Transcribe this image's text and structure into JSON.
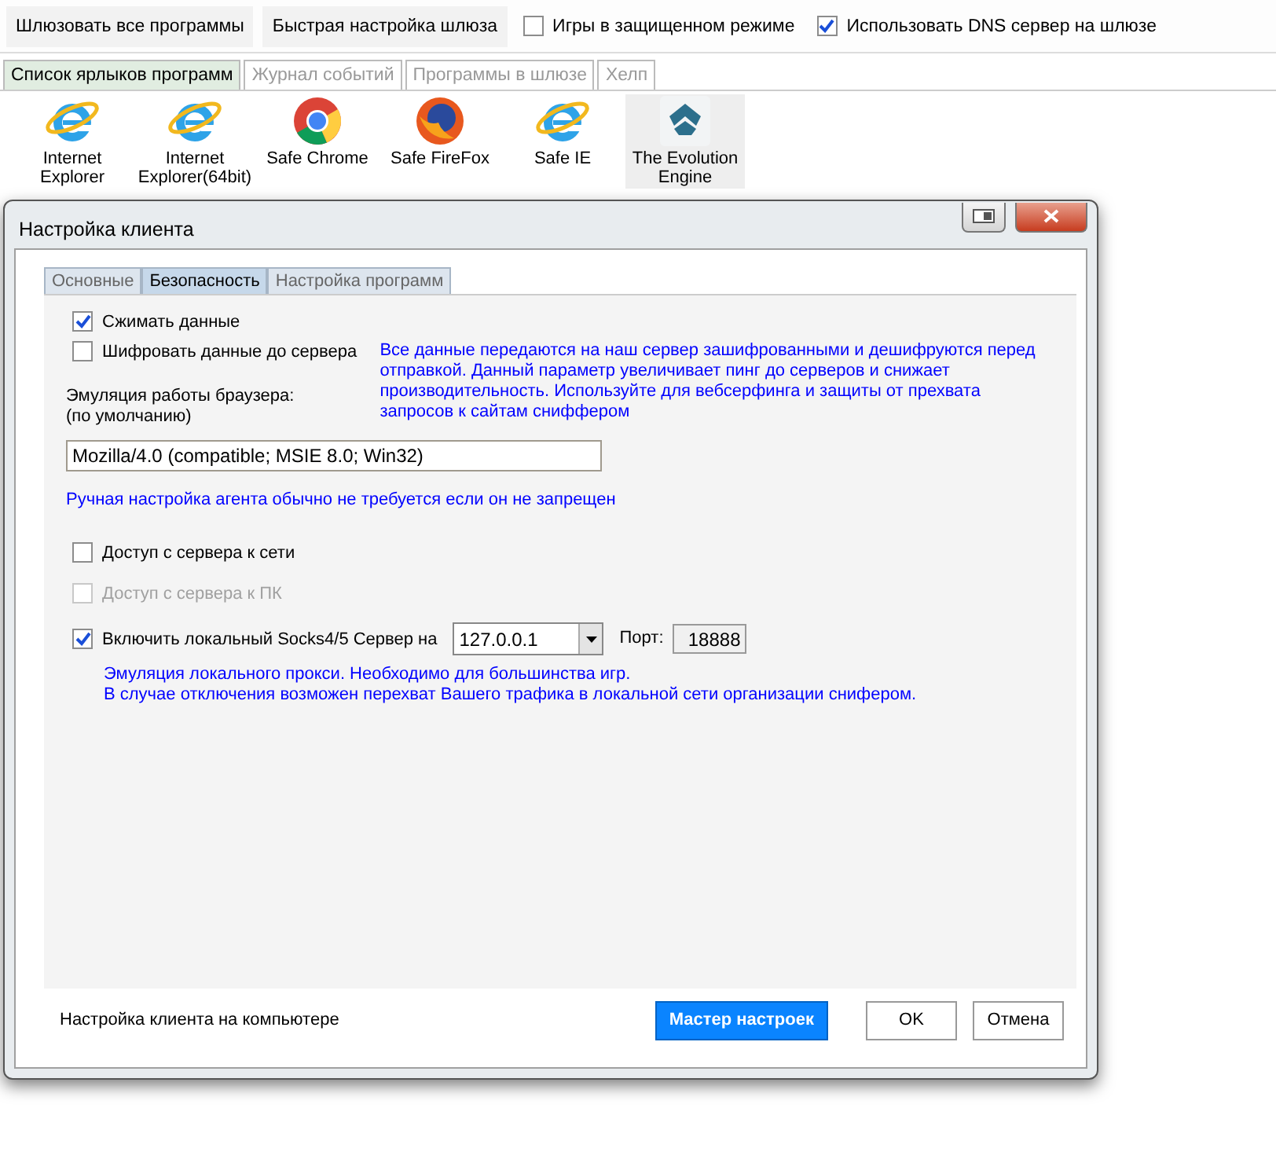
{
  "toolbar": [
    {
      "kind": "button",
      "label": "Шлюзовать все программы"
    },
    {
      "kind": "button",
      "label": "Быстрая настройка шлюза"
    },
    {
      "kind": "checkbox",
      "label": "Игры в защищенном режиме",
      "checked": false
    },
    {
      "kind": "checkbox",
      "label": "Использовать DNS сервер на шлюзе",
      "checked": true
    }
  ],
  "tabs": [
    {
      "label": "Список ярлыков программ",
      "selected": true
    },
    {
      "label": "Журнал событий",
      "selected": false
    },
    {
      "label": "Программы в шлюзе",
      "selected": false
    },
    {
      "label": "Хелп",
      "selected": false
    }
  ],
  "shortcuts": [
    {
      "kind": "ie",
      "label": "Internet\nExplorer",
      "selected": false
    },
    {
      "kind": "ie",
      "label": "Internet\nExplorer(64bit)",
      "selected": false
    },
    {
      "kind": "chrome",
      "label": "Safe Chrome",
      "selected": false
    },
    {
      "kind": "firefox",
      "label": "Safe FireFox",
      "selected": false
    },
    {
      "kind": "ie",
      "label": "Safe IE",
      "selected": false
    },
    {
      "kind": "emblem",
      "label": "The Evolution\nEngine",
      "selected": true
    }
  ],
  "dialog": {
    "title": "Настройка клиента",
    "tabs": [
      {
        "label": "Основные",
        "selected": false
      },
      {
        "label": "Безопасность",
        "selected": true
      },
      {
        "label": "Настройка программ",
        "selected": false
      }
    ],
    "compress": {
      "label": "Сжимать данные",
      "checked": true
    },
    "encrypt": {
      "label": "Шифровать данные до сервера",
      "checked": false
    },
    "encrypt_note": "Все данные передаются на наш сервер зашифрованными и дешифруются перед отправкой. Данный параметр увеличивает пинг до серверов и снижает производительность. Используйте для вебсерфинга и защиты от прехвата запросов к сайтам сниффером",
    "browser_label": [
      "Эмуляция работы браузера:",
      "(по умолчанию)"
    ],
    "user_agent": "Mozilla/4.0 (compatible; MSIE 8.0; Win32)",
    "agent_note": "Ручная настройка агента обычно не требуется если он не запрещен",
    "access": [
      {
        "label": "Доступ с сервера к сети",
        "checked": false,
        "disabled": false
      },
      {
        "label": "Доступ с сервера к ПК",
        "checked": false,
        "disabled": true
      }
    ],
    "socks": {
      "label": "Включить локальный Socks4/5 Сервер на",
      "checked": true,
      "address": "127.0.0.1",
      "port_label": "Порт:",
      "port": "18888"
    },
    "socks_notes": [
      "Эмуляция локального прокси. Необходимо для большинства игр.",
      "В случае отключения возможен перехват Вашего трафика в локальной сети организации снифером."
    ],
    "footer": "Настройка клиента на компьютере",
    "buttons": [
      {
        "kind": "primary",
        "label": "Мастер настроек"
      },
      {
        "kind": "normal",
        "label": "OK"
      },
      {
        "kind": "normal",
        "label": "Отмена"
      }
    ]
  }
}
